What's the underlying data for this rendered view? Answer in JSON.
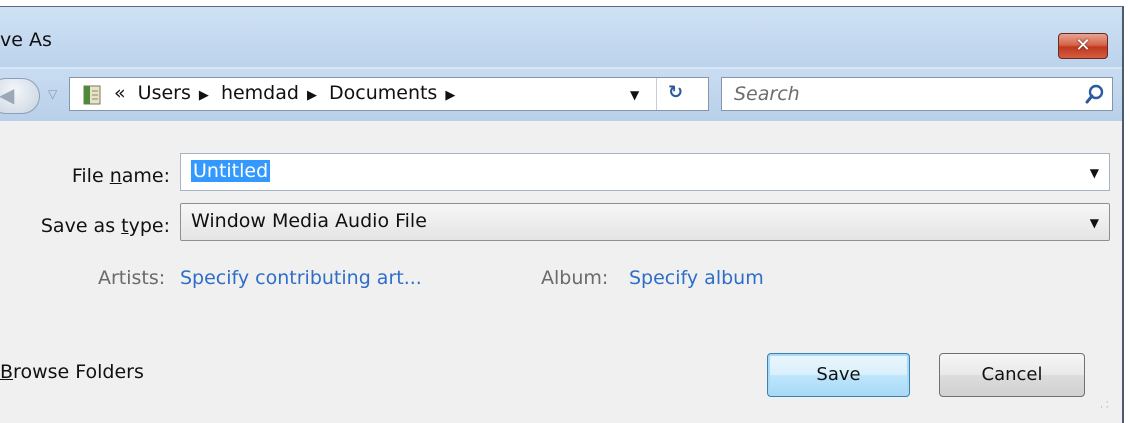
{
  "window": {
    "title": "ve As",
    "close_symbol": "✕"
  },
  "nav": {
    "back_symbol": "◀",
    "history_dropdown": "▽",
    "breadcrumb_prefix": "«",
    "breadcrumbs": [
      "Users",
      "hemdad",
      "Documents"
    ],
    "breadcrumb_separator": "▶",
    "address_dropdown": "▼",
    "refresh_symbol": "↻",
    "search_placeholder": "Search"
  },
  "form": {
    "file_name_label_pre": "File ",
    "file_name_label_u": "n",
    "file_name_label_post": "ame:",
    "file_name_value": "Untitled",
    "save_type_label_pre": "Save as ",
    "save_type_label_u": "t",
    "save_type_label_post": "ype:",
    "save_type_value": "Window Media Audio File",
    "dropdown_symbol": "▼"
  },
  "metadata": {
    "artists_label": "Artists:",
    "artists_value": "Specify contributing art...",
    "album_label": "Album:",
    "album_value": "Specify album"
  },
  "footer": {
    "browse_u": "B",
    "browse_rest": "rowse Folders",
    "save_label": "Save",
    "cancel_label": "Cancel"
  },
  "icons": {
    "folder": "folder-icon",
    "search": "search-icon",
    "refresh": "refresh-icon",
    "close": "close-icon"
  }
}
